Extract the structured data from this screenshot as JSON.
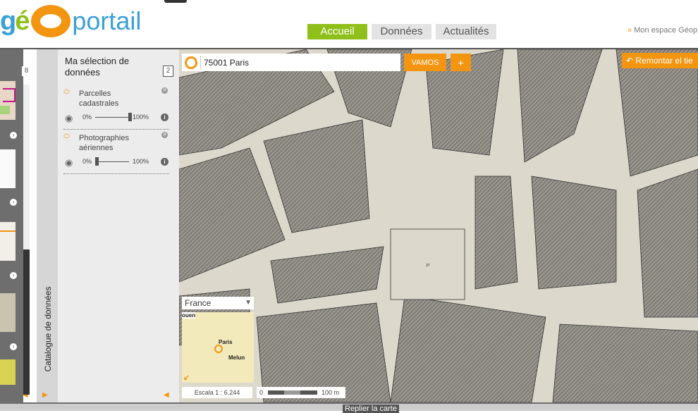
{
  "header": {
    "logo": "géOportail",
    "nav": [
      {
        "label": "Accueil",
        "active": true
      },
      {
        "label": "Données",
        "active": false
      },
      {
        "label": "Actualités",
        "active": false
      }
    ],
    "my_space": "Mon espace Géop"
  },
  "thumbs": {
    "count": "8"
  },
  "catalog": {
    "label": "Catalogue de données"
  },
  "selection": {
    "title": "Ma sélection de données",
    "count": "2",
    "layers": [
      {
        "name": "Parcelles cadastrales",
        "min": "0%",
        "max": "100%",
        "opacity": 1.0
      },
      {
        "name": "Photographies aériennes",
        "min": "0%",
        "max": "100%",
        "opacity": 0.0
      }
    ]
  },
  "map": {
    "search_value": "75001 Paris",
    "go_label": "VAMOS",
    "plus_label": "+",
    "back_label": "Remontar el tie",
    "minimap": {
      "region": "France",
      "places": [
        "ouen",
        "Paris",
        "Melun"
      ]
    },
    "scale": "Escala 1 :  6.244",
    "scalebar_min": "0",
    "scalebar_max": "100 m",
    "label_37": "37"
  },
  "footer": {
    "collapse_label": "Replier la carte"
  },
  "colors": {
    "accent": "#f39511",
    "green": "#8fbf1a",
    "blue": "#3aa0d8"
  }
}
